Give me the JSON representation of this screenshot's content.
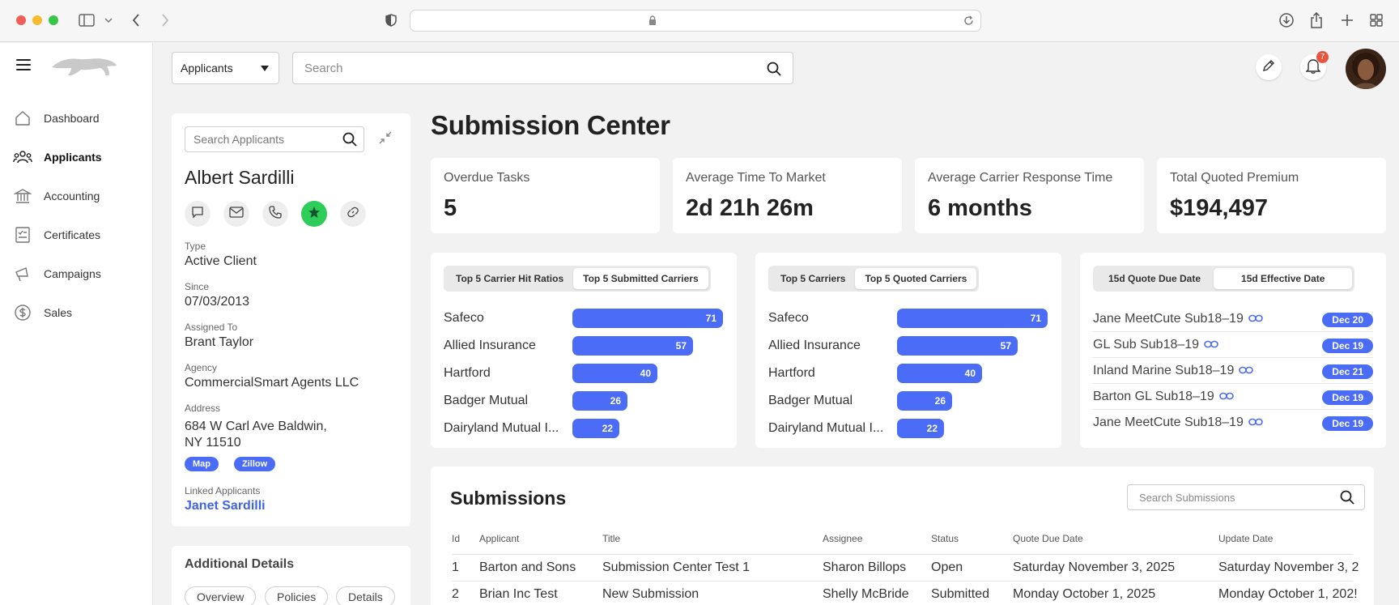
{
  "browser": {
    "url": ""
  },
  "topbar": {
    "entity_select": "Applicants",
    "search_placeholder": "Search",
    "notification_count": "7"
  },
  "sidebar": {
    "items": [
      {
        "label": "Dashboard",
        "icon": "home-icon"
      },
      {
        "label": "Applicants",
        "icon": "people-icon"
      },
      {
        "label": "Accounting",
        "icon": "bank-icon"
      },
      {
        "label": "Certificates",
        "icon": "certificate-icon"
      },
      {
        "label": "Campaigns",
        "icon": "megaphone-icon"
      },
      {
        "label": "Sales",
        "icon": "dollar-icon"
      }
    ]
  },
  "applicant": {
    "search_placeholder": "Search Applicants",
    "name": "Albert Sardilli",
    "type_label": "Type",
    "type": "Active Client",
    "since_label": "Since",
    "since": "07/03/2013",
    "assigned_label": "Assigned To",
    "assigned": "Brant Taylor",
    "agency_label": "Agency",
    "agency": "CommercialSmart Agents LLC",
    "address_label": "Address",
    "address_line1": "684 W Carl Ave Baldwin,",
    "address_line2": "NY 11510",
    "map_button": "Map",
    "zillow_button": "Zillow",
    "linked_label": "Linked Applicants",
    "linked": "Janet Sardilli"
  },
  "details": {
    "title": "Additional Details",
    "tabs": [
      "Overview",
      "Policies",
      "Details"
    ]
  },
  "page_title": "Submission Center",
  "stats": [
    {
      "label": "Overdue Tasks",
      "value": "5"
    },
    {
      "label": "Average Time To Market",
      "value": "2d 21h 26m"
    },
    {
      "label": "Average Carrier Response Time",
      "value": "6 months"
    },
    {
      "label": "Total Quoted Premium",
      "value": "$194,497"
    }
  ],
  "panels": {
    "carriers_a": {
      "tabs": [
        "Top 5 Carrier Hit Ratios",
        "Top 5 Submitted Carriers"
      ],
      "active": 1
    },
    "carriers_b": {
      "tabs": [
        "Top 5 Carriers",
        "Top 5 Quoted Carriers"
      ],
      "active": 1
    },
    "dates": {
      "tabs": [
        "15d Quote Due Date",
        "15d Effective Date"
      ],
      "active": 1,
      "rows": [
        {
          "label": "Jane MeetCute Sub18–19",
          "date": "Dec 20"
        },
        {
          "label": "GL Sub Sub18–19",
          "date": "Dec 19"
        },
        {
          "label": "Inland Marine Sub18–19",
          "date": "Dec 21"
        },
        {
          "label": "Barton GL Sub18–19",
          "date": "Dec 19"
        },
        {
          "label": "Jane MeetCute Sub18–19",
          "date": "Dec 19"
        }
      ]
    }
  },
  "chart_data": [
    {
      "type": "bar",
      "orientation": "horizontal",
      "categories": [
        "Safeco",
        "Allied Insurance",
        "Hartford",
        "Badger Mutual",
        "Dairyland Mutual I..."
      ],
      "values": [
        71,
        57,
        40,
        26,
        22
      ]
    },
    {
      "type": "bar",
      "orientation": "horizontal",
      "categories": [
        "Safeco",
        "Allied Insurance",
        "Hartford",
        "Badger Mutual",
        "Dairyland Mutual I..."
      ],
      "values": [
        71,
        57,
        40,
        26,
        22
      ]
    }
  ],
  "submissions": {
    "title": "Submissions",
    "search_placeholder": "Search Submissions",
    "columns": [
      "Id",
      "Applicant",
      "Title",
      "Assignee",
      "Status",
      "Quote Due Date",
      "Update Date"
    ],
    "rows": [
      [
        "1",
        "Barton and Sons",
        "Submission Center Test 1",
        "Sharon Billops",
        "Open",
        "Saturday November 3, 2025",
        "Saturday November 3, 2"
      ],
      [
        "2",
        "Brian Inc Test",
        "New Submission",
        "Shelly McBride",
        "Submitted",
        "Monday October 1, 2025",
        "Monday October 1, 202!"
      ]
    ]
  },
  "colors": {
    "accent": "#4a6cf7",
    "link": "#3f63e8",
    "badge": "#e8543e",
    "star": "#2ecc58"
  }
}
